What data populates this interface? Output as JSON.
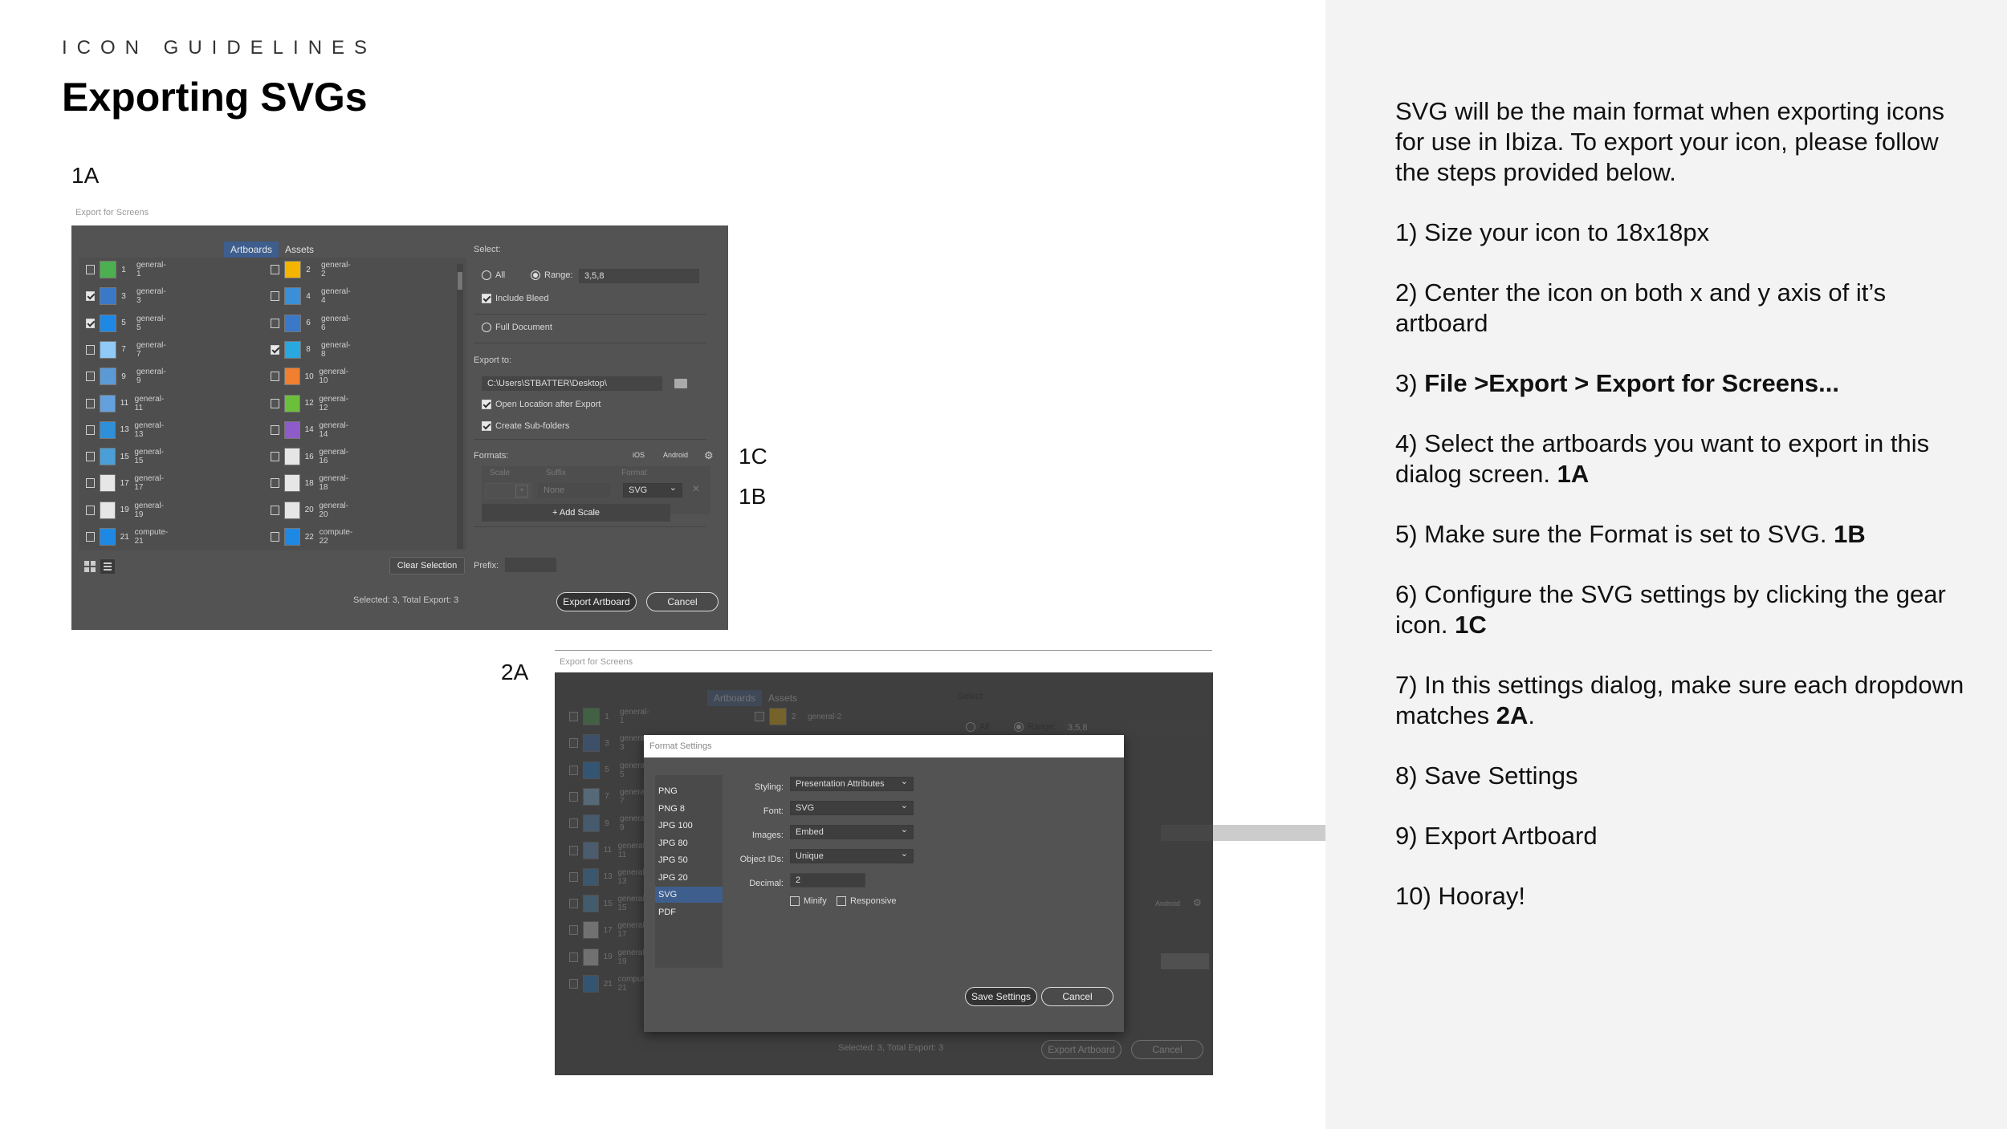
{
  "header": {
    "eyebrow": "ICON GUIDELINES",
    "title": "Exporting SVGs"
  },
  "callouts": {
    "a1": "1A",
    "c1": "1C",
    "b1": "1B",
    "a2": "2A"
  },
  "instructions": {
    "intro": "SVG will be the main format when exporting icons for use in Ibiza. To export your icon, please follow the steps provided below.",
    "s1": "1) Size your icon to 18x18px",
    "s2": "2) Center the icon on both x and y axis of it’s artboard",
    "s3_prefix": "3) ",
    "s3_bold": "File >Export > Export for Screens...",
    "s4_text": "4) Select the artboards you want to export in this dialog screen. ",
    "s4_ref": "1A",
    "s5_text": "5) Make sure the Format is set to SVG. ",
    "s5_ref": "1B",
    "s6_text": "6) Configure the SVG settings by clicking the gear icon. ",
    "s6_ref": "1C",
    "s7_text": "7) In this settings dialog, make sure each dropdown matches ",
    "s7_ref": "2A",
    "s7_end": ".",
    "s8": "8) Save Settings",
    "s9": "9) Export Artboard",
    "s10": "10) Hooray!"
  },
  "export_dialog": {
    "caption": "Export for Screens",
    "tabs": [
      "Artboards",
      "Assets"
    ],
    "artboards_left": [
      {
        "num": "1",
        "name": "general-1",
        "checked": false,
        "color": "#4caf50"
      },
      {
        "num": "3",
        "name": "general-3",
        "checked": true,
        "color": "#3a78c8"
      },
      {
        "num": "5",
        "name": "general-5",
        "checked": true,
        "color": "#1e88e5"
      },
      {
        "num": "7",
        "name": "general-7",
        "checked": false,
        "color": "#90caf9"
      },
      {
        "num": "9",
        "name": "general-9",
        "checked": false,
        "color": "#5c9ad6"
      },
      {
        "num": "11",
        "name": "general-11",
        "checked": false,
        "color": "#64a0dc"
      },
      {
        "num": "13",
        "name": "general-13",
        "checked": false,
        "color": "#2f8fd8"
      },
      {
        "num": "15",
        "name": "general-15",
        "checked": false,
        "color": "#4a9fd8"
      },
      {
        "num": "17",
        "name": "general-17",
        "checked": false,
        "color": "#e6e6e6"
      },
      {
        "num": "19",
        "name": "general-19",
        "checked": false,
        "color": "#e6e6e6"
      },
      {
        "num": "21",
        "name": "compute-21",
        "checked": false,
        "color": "#1e88e5"
      }
    ],
    "artboards_right": [
      {
        "num": "2",
        "name": "general-2",
        "checked": false,
        "color": "#f5b400"
      },
      {
        "num": "4",
        "name": "general-4",
        "checked": false,
        "color": "#3a8fd8"
      },
      {
        "num": "6",
        "name": "general-6",
        "checked": false,
        "color": "#3a78c8"
      },
      {
        "num": "8",
        "name": "general-8",
        "checked": true,
        "color": "#29a8e0"
      },
      {
        "num": "10",
        "name": "general-10",
        "checked": false,
        "color": "#f08030"
      },
      {
        "num": "12",
        "name": "general-12",
        "checked": false,
        "color": "#6bbf3a"
      },
      {
        "num": "14",
        "name": "general-14",
        "checked": false,
        "color": "#8e5cc8"
      },
      {
        "num": "16",
        "name": "general-16",
        "checked": false,
        "color": "#e6e6e6"
      },
      {
        "num": "18",
        "name": "general-18",
        "checked": false,
        "color": "#e6e6e6"
      },
      {
        "num": "20",
        "name": "general-20",
        "checked": false,
        "color": "#e6e6e6"
      },
      {
        "num": "22",
        "name": "compute-22",
        "checked": false,
        "color": "#1e88e5"
      }
    ],
    "select_label": "Select:",
    "all_label": "All",
    "range_label": "Range:",
    "range_value": "3,5,8",
    "include_bleed": "Include Bleed",
    "full_document": "Full Document",
    "export_to_label": "Export to:",
    "export_path": "C:\\Users\\STBATTER\\Desktop\\",
    "open_location": "Open Location after Export",
    "create_subfolders": "Create Sub-folders",
    "formats_label": "Formats:",
    "ios_label": "iOS",
    "android_label": "Android",
    "col_scale": "Scale",
    "col_suffix": "Suffix",
    "col_format": "Format",
    "suffix_placeholder": "None",
    "format_value": "SVG",
    "add_scale": "+ Add Scale",
    "clear_selection": "Clear Selection",
    "prefix_label": "Prefix:",
    "status": "Selected: 3, Total Export: 3",
    "export_button": "Export Artboard",
    "cancel_button": "Cancel"
  },
  "settings_dialog": {
    "caption": "Export for Screens",
    "title": "Format Settings",
    "formats": [
      "PNG",
      "PNG 8",
      "JPG 100",
      "JPG 80",
      "JPG 50",
      "JPG 20",
      "SVG",
      "PDF"
    ],
    "selected_format": "SVG",
    "styling_label": "Styling:",
    "styling_value": "Presentation Attributes",
    "font_label": "Font:",
    "font_value": "SVG",
    "images_label": "Images:",
    "images_value": "Embed",
    "object_ids_label": "Object IDs:",
    "object_ids_value": "Unique",
    "decimal_label": "Decimal:",
    "decimal_value": "2",
    "minify_label": "Minify",
    "responsive_label": "Responsive",
    "save_button": "Save Settings",
    "cancel_button": "Cancel",
    "bg_tabs": [
      "Artboards",
      "Assets"
    ],
    "bg_select": "Select:",
    "bg_all": "All",
    "bg_range": "Range:",
    "bg_range_value": "3,5,8",
    "bg_android": "Android",
    "bg_status": "Selected: 3, Total Export: 3",
    "bg_export": "Export Artboard",
    "bg_cancel": "Cancel",
    "bg_rows": [
      {
        "num": "1",
        "name": "general-1",
        "color": "#4caf50"
      },
      {
        "num": "3",
        "name": "general-3",
        "color": "#3a78c8"
      },
      {
        "num": "5",
        "name": "general-5",
        "color": "#1e88e5"
      },
      {
        "num": "7",
        "name": "general-7",
        "color": "#90caf9"
      },
      {
        "num": "9",
        "name": "general-9",
        "color": "#5c9ad6"
      },
      {
        "num": "11",
        "name": "general-11",
        "color": "#64a0dc"
      },
      {
        "num": "13",
        "name": "general-13",
        "color": "#2f8fd8"
      },
      {
        "num": "15",
        "name": "general-15",
        "color": "#4a9fd8"
      },
      {
        "num": "17",
        "name": "general-17",
        "color": "#e6e6e6"
      },
      {
        "num": "19",
        "name": "general-19",
        "color": "#e6e6e6"
      },
      {
        "num": "21",
        "name": "compute-21",
        "color": "#1e88e5"
      }
    ],
    "bg_right_num": "2",
    "bg_right_name": "general-2"
  }
}
